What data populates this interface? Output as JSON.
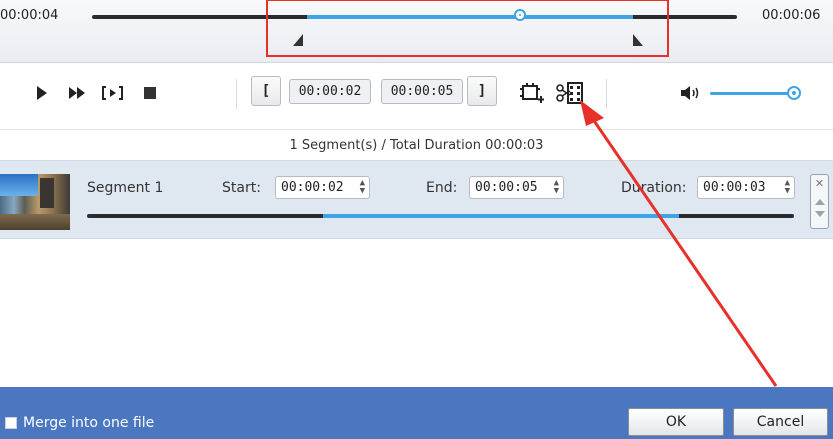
{
  "timeline": {
    "current_time": "00:00:04",
    "end_time": "00:00:06",
    "playhead_fraction": 0.66,
    "selection_start_fraction": 0.33,
    "selection_end_fraction": 0.83
  },
  "toolbar": {
    "play_icon": "play-icon",
    "fast_forward_icon": "fast-forward-icon",
    "step_icon": "frame-step-icon",
    "stop_icon": "stop-icon",
    "set_start_label": "[",
    "start_time": "00:00:02",
    "end_time": "00:00:05",
    "set_end_label": "]",
    "new_segment_icon": "add-segment-icon",
    "split_icon": "scissors-film-icon",
    "volume_icon": "speaker-icon",
    "volume_level": 1.0
  },
  "summary": {
    "text": "1 Segment(s) / Total Duration 00:00:03"
  },
  "segments": [
    {
      "name": "Segment 1",
      "start_label": "Start:",
      "start_value": "00:00:02",
      "end_label": "End:",
      "end_value": "00:00:05",
      "duration_label": "Duration:",
      "duration_value": "00:00:03",
      "range_start_fraction": 0.34,
      "range_end_fraction": 0.84
    }
  ],
  "footer": {
    "merge_label": "Merge into one file",
    "merge_checked": false,
    "ok_label": "OK",
    "cancel_label": "Cancel"
  },
  "colors": {
    "accent": "#3fa3e6",
    "footer_bg": "#4a77bf",
    "annotation": "#e8302a"
  }
}
